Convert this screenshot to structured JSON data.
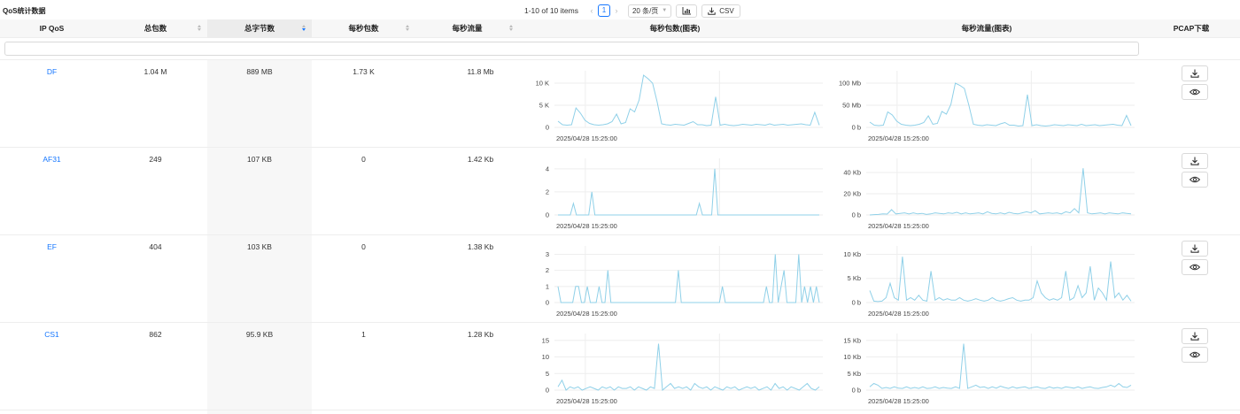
{
  "panel": {
    "title": "QoS统计数据"
  },
  "pagination": {
    "info": "1-10 of 10 items",
    "prev": "‹",
    "current_page": "1",
    "next": "›",
    "page_size": "20 条/页",
    "csv_label": "CSV"
  },
  "columns": {
    "ip_qos": "IP QoS",
    "total_packets": "总包数",
    "total_bytes": "总字节数",
    "pps": "每秒包数",
    "bps": "每秒流量",
    "pps_chart": "每秒包数(图表)",
    "bps_chart": "每秒流量(图表)",
    "pcap": "PCAP下载"
  },
  "filter": {
    "placeholder": ""
  },
  "rows": [
    {
      "qos": "DF",
      "total_packets": "1.04 M",
      "total_bytes": "889 MB",
      "pps": "1.73 K",
      "bps": "11.8 Mb"
    },
    {
      "qos": "AF31",
      "total_packets": "249",
      "total_bytes": "107 KB",
      "pps": "0",
      "bps": "1.42 Kb"
    },
    {
      "qos": "EF",
      "total_packets": "404",
      "total_bytes": "103 KB",
      "pps": "0",
      "bps": "1.38 Kb"
    },
    {
      "qos": "CS1",
      "total_packets": "862",
      "total_bytes": "95.9 KB",
      "pps": "1",
      "bps": "1.28 Kb"
    }
  ],
  "chart_data": [
    {
      "type": "line",
      "row": "DF",
      "metric": "每秒包数",
      "x_start_label": "2025/04/28 15:25:00",
      "yticks": [
        "10 K",
        "5 K",
        "0"
      ],
      "ylim": [
        0,
        12000
      ],
      "values": [
        1400,
        600,
        500,
        600,
        4400,
        3200,
        1600,
        900,
        600,
        500,
        600,
        800,
        1300,
        3000,
        800,
        1100,
        4200,
        3500,
        6200,
        11800,
        11000,
        10000,
        5800,
        800,
        600,
        500,
        700,
        600,
        500,
        900,
        1300,
        600,
        600,
        400,
        500,
        6900,
        500,
        700,
        500,
        400,
        500,
        700,
        600,
        500,
        700,
        600,
        500,
        800,
        500,
        600,
        700,
        500,
        600,
        700,
        800,
        600,
        500,
        3400,
        500
      ]
    },
    {
      "type": "line",
      "row": "DF",
      "metric": "每秒流量",
      "x_start_label": "2025/04/28 15:25:00",
      "yticks": [
        "100 Mb",
        "50 Mb",
        "0 b"
      ],
      "ylim": [
        0,
        120
      ],
      "values": [
        12,
        5,
        4,
        5,
        35,
        28,
        14,
        7,
        5,
        4,
        5,
        7,
        11,
        26,
        7,
        9,
        36,
        30,
        52,
        100,
        95,
        88,
        50,
        7,
        5,
        4,
        6,
        5,
        4,
        8,
        11,
        5,
        5,
        3,
        4,
        74,
        4,
        6,
        4,
        3,
        4,
        6,
        5,
        4,
        6,
        5,
        4,
        7,
        4,
        5,
        6,
        4,
        5,
        6,
        7,
        5,
        4,
        27,
        4
      ]
    },
    {
      "type": "line",
      "row": "AF31",
      "metric": "每秒包数",
      "x_start_label": "2025/04/28 15:25:00",
      "yticks": [
        "4",
        "2",
        "0"
      ],
      "ylim": [
        0,
        4.6
      ],
      "values": [
        0,
        0,
        0,
        0,
        0,
        1,
        0,
        0,
        0,
        0,
        0,
        2,
        0,
        0,
        0,
        0,
        0,
        0,
        0,
        0,
        0,
        0,
        0,
        0,
        0,
        0,
        0,
        0,
        0,
        0,
        0,
        0,
        0,
        0,
        0,
        0,
        0,
        0,
        0,
        0,
        0,
        0,
        0,
        0,
        0,
        0,
        1,
        0,
        0,
        0,
        0,
        4,
        0,
        0,
        0,
        0,
        0,
        0,
        0,
        0,
        0,
        0,
        0,
        0,
        0,
        0,
        0,
        0,
        0,
        0,
        0,
        0,
        0,
        0,
        0,
        0,
        0,
        0,
        0,
        0,
        0,
        0,
        0,
        0,
        0,
        0
      ]
    },
    {
      "type": "line",
      "row": "AF31",
      "metric": "每秒流量",
      "x_start_label": "2025/04/28 15:25:00",
      "yticks": [
        "40 Kb",
        "20 Kb",
        "0 b"
      ],
      "ylim": [
        0,
        50
      ],
      "values": [
        0,
        0.3,
        0.5,
        1,
        0.8,
        5,
        1,
        1.5,
        2,
        1,
        2,
        1,
        1.5,
        0.5,
        1,
        2,
        1.5,
        1,
        2,
        1.5,
        2.5,
        1,
        2,
        1,
        1.5,
        2,
        1,
        3,
        1.5,
        1,
        2,
        1,
        2.5,
        1.5,
        1,
        2,
        3,
        2,
        4,
        1,
        1.5,
        2,
        1.5,
        2,
        1,
        3,
        2,
        6,
        2,
        44,
        2,
        1,
        1.5,
        2,
        1,
        2,
        1.5,
        1,
        2,
        1.5,
        1
      ]
    },
    {
      "type": "line",
      "row": "EF",
      "metric": "每秒包数",
      "x_start_label": "2025/04/28 15:25:00",
      "yticks": [
        "3",
        "2",
        "1",
        "0"
      ],
      "ylim": [
        0,
        3.3
      ],
      "values": [
        1,
        0,
        0,
        0,
        0,
        0,
        1,
        1,
        0,
        0,
        1,
        0,
        0,
        0,
        1,
        0,
        0,
        2,
        0,
        0,
        0,
        0,
        0,
        0,
        0,
        0,
        0,
        0,
        0,
        0,
        0,
        0,
        0,
        0,
        0,
        0,
        0,
        0,
        0,
        0,
        0,
        2,
        0,
        0,
        0,
        0,
        0,
        0,
        0,
        0,
        0,
        0,
        0,
        0,
        0,
        0,
        1,
        0,
        0,
        0,
        0,
        0,
        0,
        0,
        0,
        0,
        0,
        0,
        0,
        0,
        0,
        1,
        0,
        0,
        3,
        0,
        1,
        2,
        0,
        0,
        0,
        0,
        3,
        0,
        1,
        0,
        1,
        0,
        1,
        0
      ]
    },
    {
      "type": "line",
      "row": "EF",
      "metric": "每秒流量",
      "x_start_label": "2025/04/28 15:25:00",
      "yticks": [
        "10 Kb",
        "5 Kb",
        "0 b"
      ],
      "ylim": [
        0,
        11
      ],
      "values": [
        2.5,
        0.3,
        0.2,
        0.3,
        1,
        4,
        1,
        0.5,
        9.5,
        0.5,
        1,
        0.5,
        1.5,
        0.5,
        0.3,
        6.5,
        0.5,
        1,
        0.5,
        0.8,
        0.5,
        0.5,
        1,
        0.5,
        0.3,
        0.5,
        0.8,
        0.5,
        0.3,
        0.5,
        1,
        0.5,
        0.3,
        0.5,
        0.8,
        1,
        0.5,
        0.3,
        0.5,
        0.5,
        1,
        4.5,
        2,
        1,
        0.5,
        0.8,
        0.5,
        1,
        6.5,
        0.5,
        1,
        3.5,
        1,
        2,
        7.5,
        0.5,
        3,
        2,
        0.5,
        8.5,
        1,
        2,
        0.5,
        1.5,
        0.3
      ]
    },
    {
      "type": "line",
      "row": "CS1",
      "metric": "每秒包数",
      "x_start_label": "2025/04/28 15:25:00",
      "yticks": [
        "15",
        "10",
        "5",
        "0"
      ],
      "ylim": [
        0,
        16
      ],
      "values": [
        1,
        3,
        0,
        1,
        0.5,
        1,
        0,
        0.5,
        1,
        0.5,
        0,
        1,
        0.5,
        1,
        0,
        1,
        0.5,
        0.5,
        1,
        0,
        1,
        0.5,
        0,
        1,
        0.5,
        14,
        0,
        1,
        2,
        0.5,
        1,
        0.5,
        1,
        0,
        2,
        1,
        0.5,
        1,
        0,
        1,
        0.5,
        0,
        1,
        0.5,
        1,
        0,
        0.5,
        1,
        0.5,
        1,
        0,
        0.5,
        1,
        0,
        2,
        0.5,
        1,
        0,
        1,
        0.5,
        0,
        1,
        2,
        0.5,
        0,
        1
      ]
    },
    {
      "type": "line",
      "row": "CS1",
      "metric": "每秒流量",
      "x_start_label": "2025/04/28 15:25:00",
      "yticks": [
        "15 Kb",
        "10 Kb",
        "5 Kb",
        "0 b"
      ],
      "ylim": [
        0,
        16
      ],
      "values": [
        1,
        2,
        1.5,
        0.5,
        0.8,
        0.5,
        1,
        0.6,
        0.5,
        1,
        0.5,
        0.8,
        0.5,
        1,
        0.5,
        0.6,
        1,
        0.5,
        0.8,
        0.6,
        0.5,
        1,
        0.5,
        14,
        0.5,
        1,
        1.5,
        0.8,
        1,
        0.5,
        1,
        0.6,
        1.2,
        0.8,
        0.5,
        1,
        0.6,
        0.8,
        1,
        0.5,
        0.8,
        1,
        0.6,
        0.5,
        1,
        0.6,
        0.8,
        0.5,
        1,
        0.8,
        0.6,
        1,
        0.5,
        0.8,
        1,
        0.6,
        0.5,
        0.8,
        1,
        1.5,
        1,
        2,
        1,
        0.8,
        1.5
      ]
    }
  ],
  "colors": {
    "accent": "#1677ff",
    "line": "#8fd0e8",
    "grid": "#eeeeee"
  },
  "icons": {
    "chart_button": "bar-chart-icon",
    "csv_button": "download-icon",
    "pcap_download": "download-icon",
    "pcap_view": "eye-icon"
  }
}
